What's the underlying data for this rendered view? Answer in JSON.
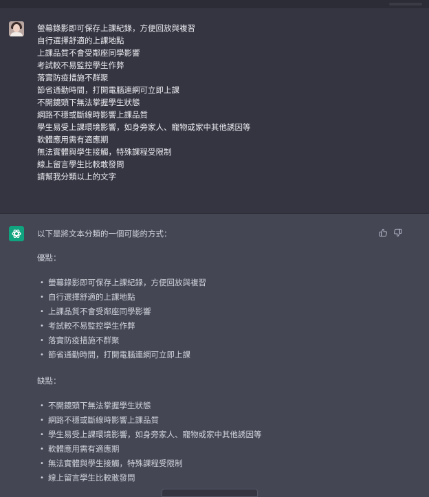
{
  "user_message": {
    "lines": [
      "螢幕錄影即可保存上課紀錄，方便回放與複習",
      "自行選擇舒適的上課地點",
      "上課品質不會受鄰座同學影響",
      "考試較不易監控學生作弊",
      "落實防疫措施不群聚",
      "節省通勤時間，打開電腦連網可立即上課",
      "不開鏡頭下無法掌握學生狀態",
      "網路不穩或斷線時影響上課品質",
      "學生易受上課環境影響，如身旁家人、寵物或家中其他誘因等",
      "軟體應用需有適應期",
      "無法實體與學生接觸，特殊課程受限制",
      "線上留言學生比較敢發問",
      "請幫我分類以上的文字"
    ]
  },
  "assistant_message": {
    "intro": "以下是將文本分類的一個可能的方式：",
    "pros_heading": "優點：",
    "pros": [
      "螢幕錄影即可保存上課紀錄，方便回放與複習",
      "自行選擇舒適的上課地點",
      "上課品質不會受鄰座同學影響",
      "考試較不易監控學生作弊",
      "落實防疫措施不群聚",
      "節省通勤時間，打開電腦連網可立即上課"
    ],
    "cons_heading": "缺點：",
    "cons": [
      "不開鏡頭下無法掌握學生狀態",
      "網路不穩或斷線時影響上課品質",
      "學生易受上課環境影響，如身旁家人、寵物或家中其他誘因等",
      "軟體應用需有適應期",
      "無法實體與學生接觸，特殊課程受限制",
      "線上留言學生比較敢發問"
    ],
    "bullet": "•"
  },
  "icons": {
    "assistant_logo": "openai-logo-icon",
    "thumbs_up": "thumbs-up-icon",
    "thumbs_down": "thumbs-down-icon"
  },
  "colors": {
    "user_bg": "#343541",
    "assistant_bg": "#444654",
    "assistant_logo_bg": "#10a37f"
  }
}
